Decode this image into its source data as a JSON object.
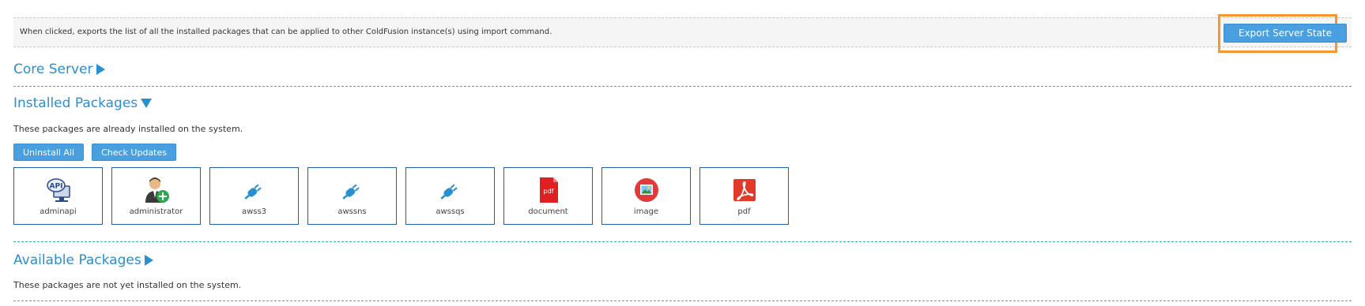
{
  "export": {
    "description": "When clicked, exports the list of all the installed packages that can be applied to other ColdFusion instance(s) using import command.",
    "button_label": "Export Server State",
    "highlight_color": "#f7952e"
  },
  "core_server": {
    "title": "Core Server",
    "expanded": false
  },
  "installed": {
    "title": "Installed Packages",
    "expanded": true,
    "description": "These packages are already installed on the system.",
    "uninstall_label": "Uninstall All",
    "check_updates_label": "Check Updates",
    "packages": [
      {
        "name": "adminapi",
        "icon": "api-monitor-icon"
      },
      {
        "name": "administrator",
        "icon": "admin-user-icon"
      },
      {
        "name": "awss3",
        "icon": "plug-icon"
      },
      {
        "name": "awssns",
        "icon": "plug-icon"
      },
      {
        "name": "awssqs",
        "icon": "plug-icon"
      },
      {
        "name": "document",
        "icon": "pdf-document-icon"
      },
      {
        "name": "image",
        "icon": "image-icon"
      },
      {
        "name": "pdf",
        "icon": "acrobat-pdf-icon"
      }
    ]
  },
  "available": {
    "title": "Available Packages",
    "expanded": false,
    "description": "These packages are not yet installed on the system."
  },
  "colors": {
    "accent": "#2a8fd0",
    "button": "#4a9fe0",
    "divider": "#3ab5a5",
    "package_border": "#1f5fa8"
  }
}
